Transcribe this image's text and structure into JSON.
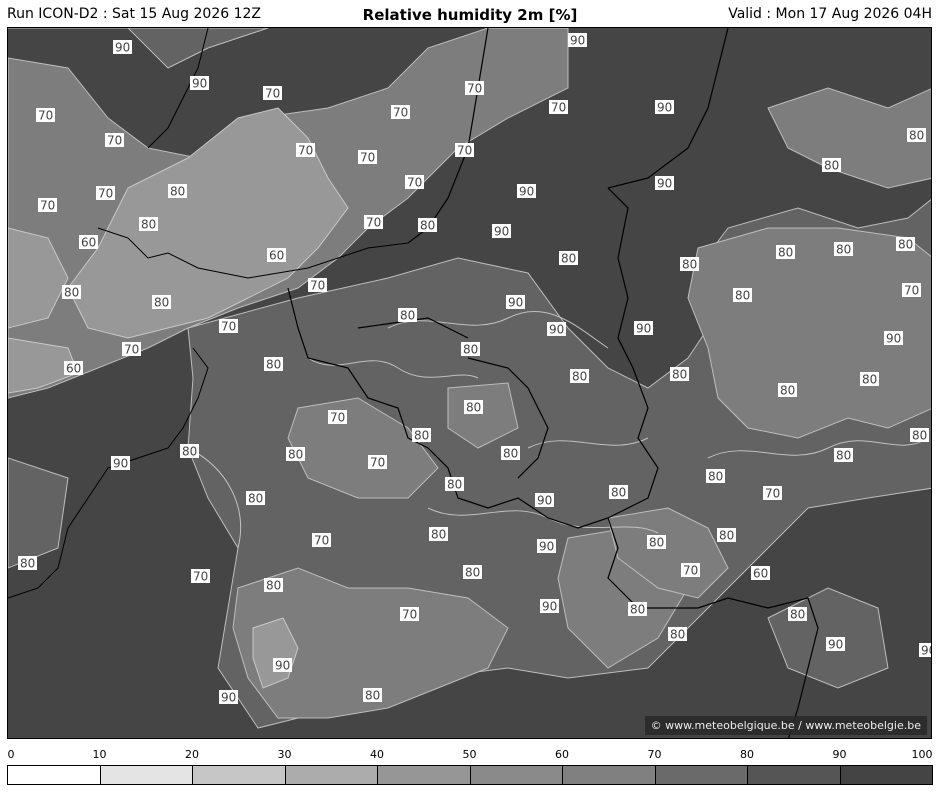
{
  "header": {
    "run": "Run ICON-D2 : Sat 15 Aug 2026 12Z",
    "title": "Relative humidity 2m [%]",
    "valid": "Valid : Mon 17 Aug 2026 04H"
  },
  "credit": "© www.meteobelgique.be / www.meteobelgie.be",
  "colors": {
    "c60": "#9a9a9a",
    "c70": "#7e7e7e",
    "c80": "#646464",
    "c90": "#454545",
    "border": "#000000",
    "contour": "#bdbdbd"
  },
  "contour_labels": [
    "90",
    "90",
    "90",
    "70",
    "70",
    "70",
    "70",
    "70",
    "70",
    "90",
    "70",
    "70",
    "80",
    "70",
    "70",
    "70",
    "80",
    "80",
    "90",
    "70",
    "80",
    "90",
    "80",
    "60",
    "60",
    "80",
    "80",
    "80",
    "70",
    "90",
    "80",
    "90",
    "80",
    "80",
    "70",
    "70",
    "90",
    "70",
    "80",
    "60",
    "80",
    "80",
    "70",
    "80",
    "80",
    "70",
    "80",
    "80",
    "90",
    "80",
    "80",
    "70",
    "80",
    "90",
    "80",
    "80",
    "90",
    "80",
    "80",
    "80",
    "80",
    "80",
    "80",
    "80",
    "80",
    "90",
    "70",
    "70",
    "80",
    "90",
    "80",
    "80",
    "80",
    "70",
    "80",
    "80",
    "70",
    "60",
    "90",
    "70",
    "80",
    "80",
    "80",
    "90",
    "90",
    "90",
    "90",
    "80"
  ],
  "colorbar": {
    "ticks": [
      "0",
      "10",
      "20",
      "30",
      "40",
      "50",
      "60",
      "70",
      "80",
      "90",
      "100"
    ],
    "colors": [
      "#ffffff",
      "#e4e4e4",
      "#c6c6c6",
      "#acacac",
      "#969696",
      "#8a8a8a",
      "#808080",
      "#6a6a6a",
      "#555555",
      "#444444"
    ]
  }
}
